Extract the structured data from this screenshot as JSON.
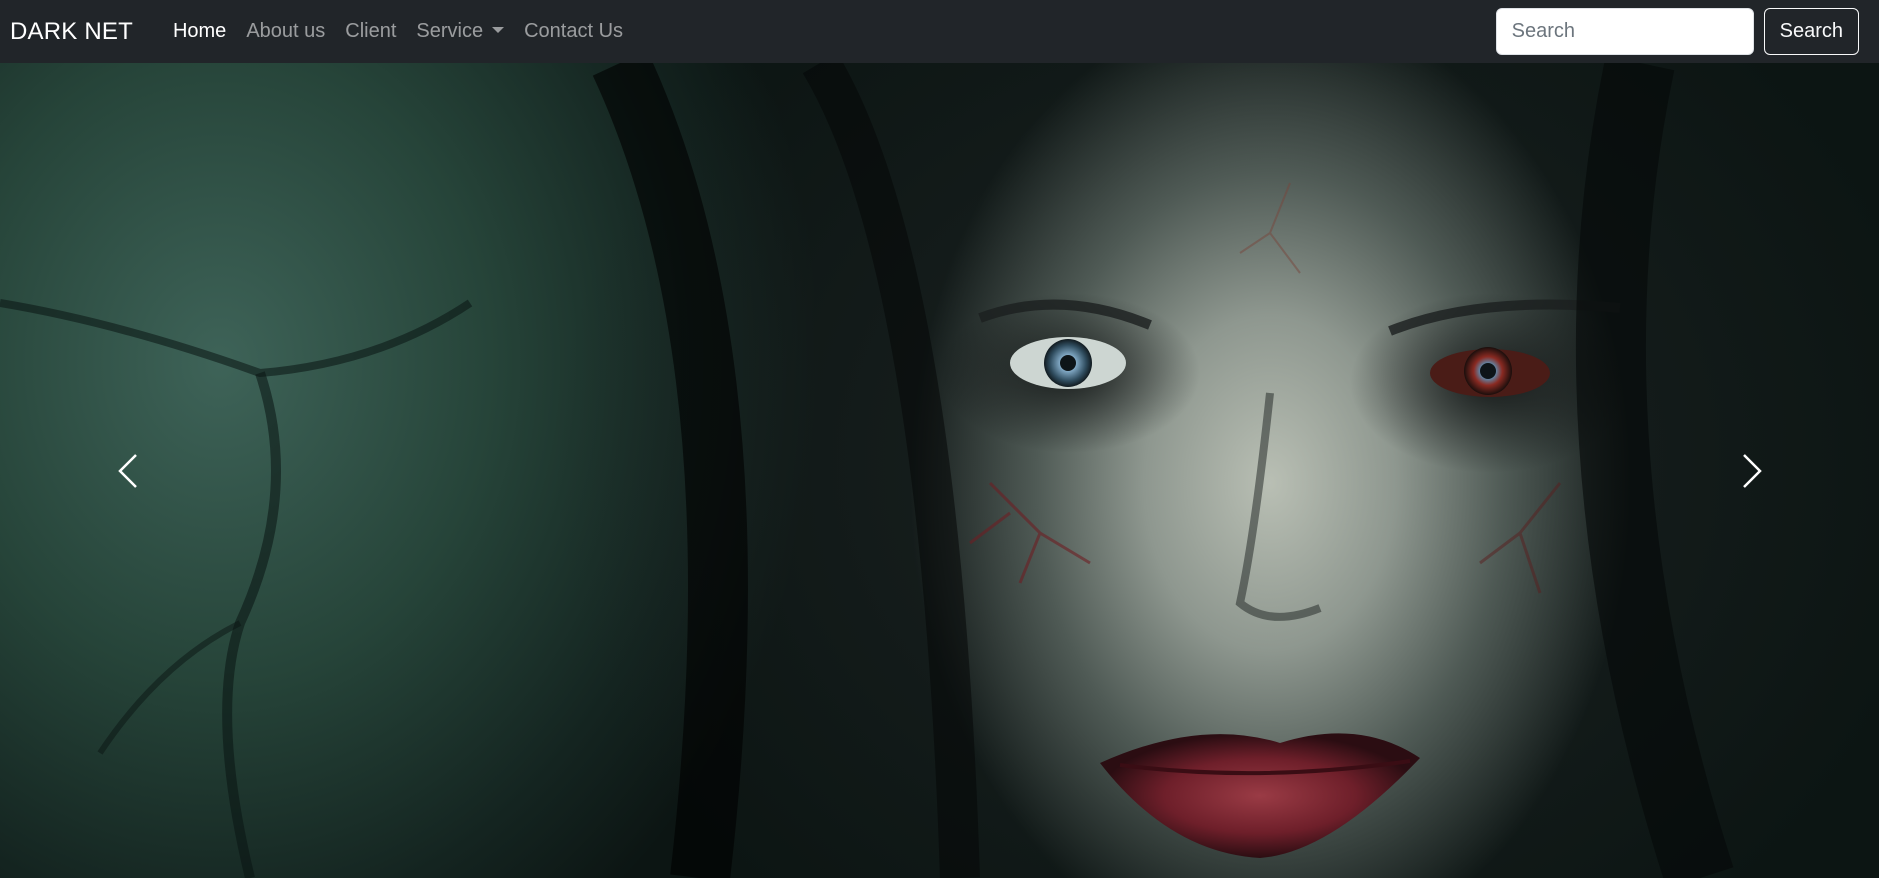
{
  "navbar": {
    "brand": "DARK NET",
    "links": [
      {
        "label": "Home"
      },
      {
        "label": "About us"
      },
      {
        "label": "Client"
      },
      {
        "label": "Service"
      },
      {
        "label": "Contact Us"
      }
    ],
    "search": {
      "placeholder": "Search",
      "value": "",
      "button_label": "Search"
    }
  },
  "carousel": {
    "prev_icon": "chevron-left-icon",
    "next_icon": "chevron-right-icon"
  },
  "colors": {
    "navbar_bg": "#212529",
    "nav_active": "#ffffff",
    "nav_muted": "rgba(255,255,255,0.55)",
    "search_outline": "#f8f9fa"
  }
}
